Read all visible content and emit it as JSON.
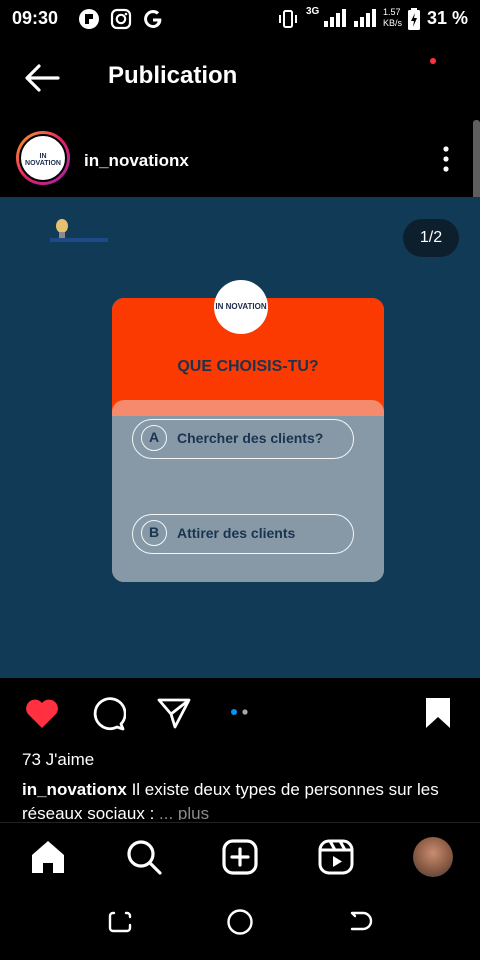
{
  "status_bar": {
    "time": "09:30",
    "network": "3G",
    "speed_value": "1.57",
    "speed_unit": "KB/s",
    "battery": "31 %"
  },
  "header": {
    "title": "Publication"
  },
  "post": {
    "username": "in_novationx",
    "page_indicator": "1/2",
    "quiz": {
      "logo_text": "IN NOVATION",
      "question": "QUE CHOISIS-TU?",
      "options": [
        {
          "letter": "A",
          "text": "Chercher des clients?"
        },
        {
          "letter": "B",
          "text": "Attirer des clients"
        }
      ]
    },
    "likes": "73 J'aime",
    "caption_user": "in_novationx",
    "caption_text": " Il existe deux types de personnes sur les réseaux sociaux :",
    "caption_more": "... plus"
  },
  "icons": {
    "back": "arrow-left-icon",
    "more": "three-dots-vertical-icon",
    "like": "heart-filled-icon",
    "comment": "comment-bubble-icon",
    "share": "paper-plane-icon",
    "save": "bookmark-filled-icon",
    "home": "home-icon",
    "search": "search-icon",
    "create": "plus-square-icon",
    "reels": "reels-icon"
  },
  "colors": {
    "like": "#ff3040",
    "quiz_header": "#fa3a00",
    "post_background": "#103a56",
    "carousel_active_dot": "#0095f6"
  }
}
